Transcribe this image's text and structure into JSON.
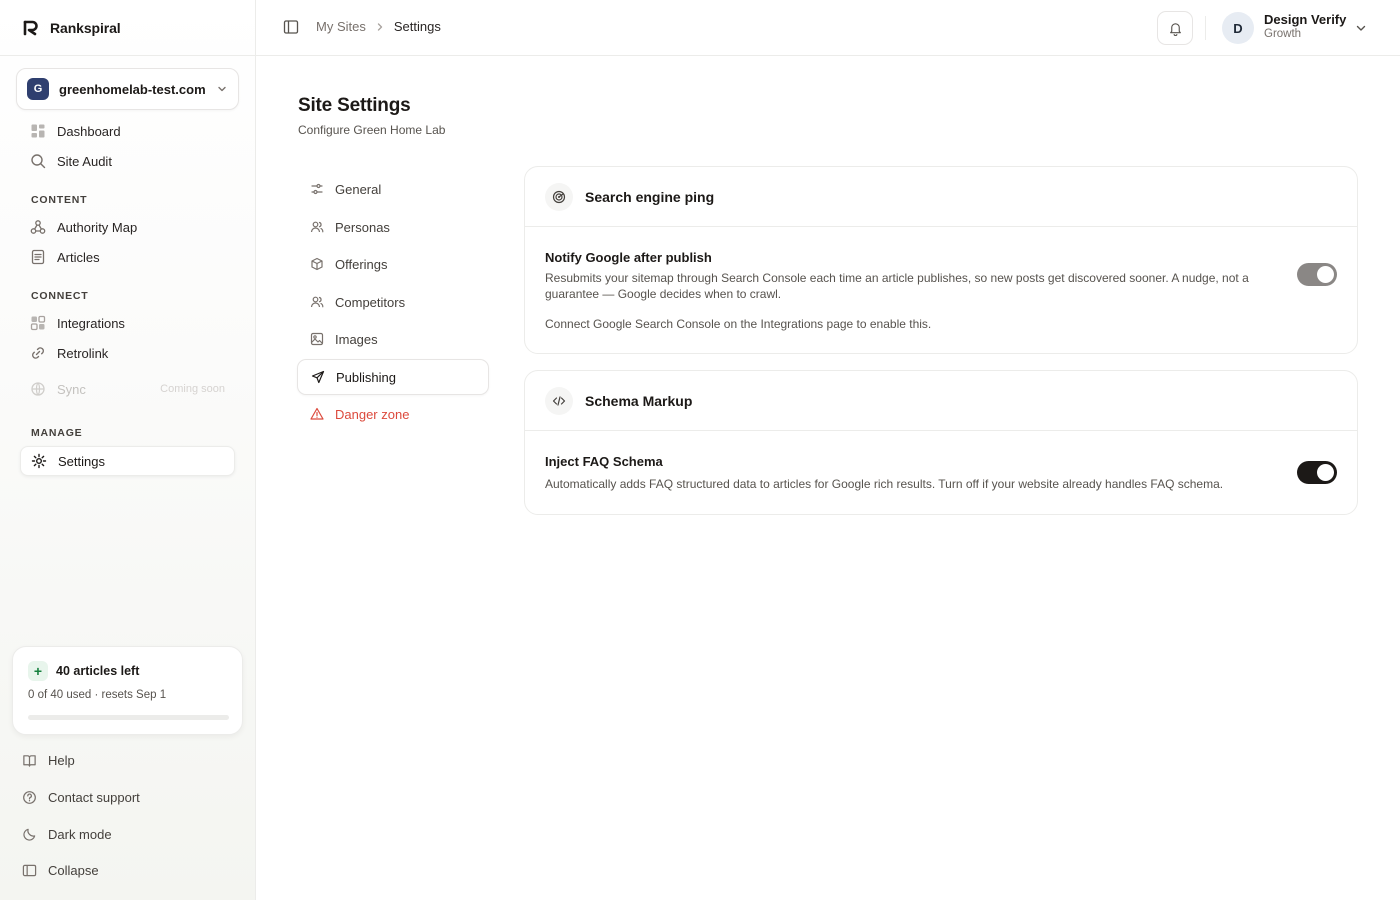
{
  "app": {
    "name": "Rankspiral"
  },
  "site": {
    "initial": "G",
    "name": "greenhomelab-test.com"
  },
  "nav": {
    "dashboard": "Dashboard",
    "site_audit": "Site Audit",
    "content_label": "CONTENT",
    "authority_map": "Authority Map",
    "articles": "Articles",
    "connect_label": "CONNECT",
    "integrations": "Integrations",
    "retrolink": "Retrolink",
    "sync": "Sync",
    "sync_badge": "Coming soon",
    "manage_label": "MANAGE",
    "settings": "Settings"
  },
  "usage": {
    "title": "40 articles left",
    "subtitle": "0 of 40 used · resets Sep 1",
    "used": 0,
    "total": 40,
    "progress": 0.0
  },
  "footer": {
    "help": "Help",
    "contact": "Contact support",
    "dark_mode": "Dark mode",
    "collapse": "Collapse"
  },
  "header": {
    "breadcrumb_root": "My Sites",
    "breadcrumb_current": "Settings",
    "user_initial": "D",
    "user_name": "Design Verify",
    "user_plan": "Growth"
  },
  "page": {
    "title": "Site Settings",
    "subtitle": "Configure Green Home Lab"
  },
  "tabs": {
    "general": "General",
    "personas": "Personas",
    "offerings": "Offerings",
    "competitors": "Competitors",
    "images": "Images",
    "publishing": "Publishing",
    "danger": "Danger zone"
  },
  "ping_card": {
    "title": "Search engine ping",
    "row_title": "Notify Google after publish",
    "row_desc": "Resubmits your sitemap through Search Console each time an article publishes, so new posts get discovered sooner. A nudge, not a guarantee — Google decides when to crawl.",
    "note": "Connect Google Search Console on the Integrations page to enable this.",
    "toggle_on": true,
    "toggle_disabled": true
  },
  "schema_card": {
    "title": "Schema Markup",
    "row_title": "Inject FAQ Schema",
    "row_desc": "Automatically adds FAQ structured data to articles for Google rich results. Turn off if your website already handles FAQ schema.",
    "toggle_on": true
  },
  "colors": {
    "accent_dark": "#1c1917",
    "danger": "#dc4a3d",
    "site_avatar": "#2f3f6f",
    "progress": "#16a34a"
  }
}
